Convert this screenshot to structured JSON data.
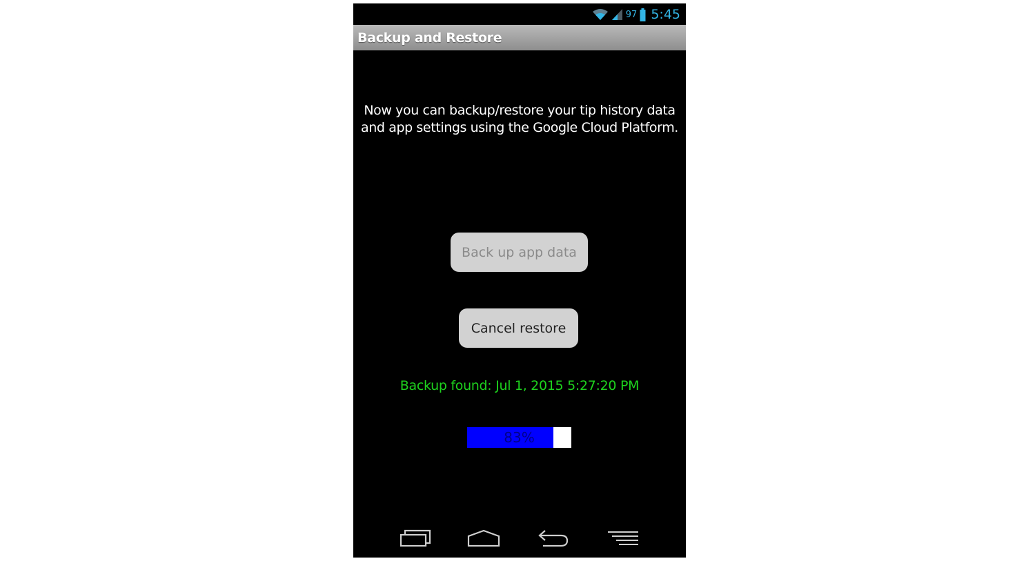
{
  "status_bar": {
    "battery_percent": "97",
    "time": "5:45",
    "wifi_icon": "wifi-icon",
    "signal_icon": "signal-icon",
    "battery_icon": "battery-icon",
    "accent_color": "#33b5e5"
  },
  "title_bar": {
    "title": "Backup and Restore"
  },
  "main": {
    "description": "Now you can backup/restore your tip history data and app settings using the Google Cloud Platform.",
    "backup_button_label": "Back up app data",
    "cancel_button_label": "Cancel restore",
    "backup_found_text": "Backup found: Jul 1, 2015 5:27:20 PM",
    "backup_found_color": "#1ed21e",
    "progress": {
      "percent": 83,
      "label": "83%",
      "fill_color": "#0000ff"
    }
  },
  "nav_bar": {
    "recent_icon": "recent-apps-icon",
    "home_icon": "home-icon",
    "back_icon": "back-icon",
    "menu_icon": "menu-icon"
  }
}
